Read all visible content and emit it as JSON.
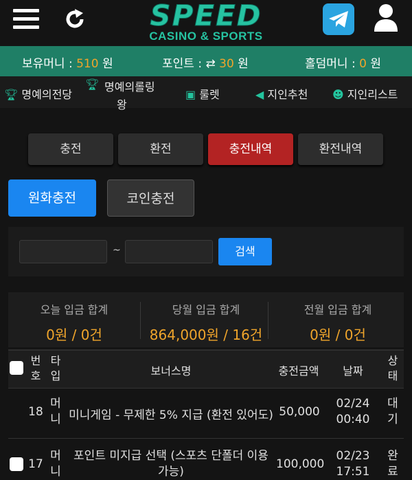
{
  "header": {
    "logo_main": "SPEED",
    "logo_sub": "CASINO & SPORTS"
  },
  "balances": {
    "cash_label": "보유머니 :",
    "cash_value": "510",
    "cash_unit": "원",
    "point_label": "포인트 :",
    "point_value": "30",
    "point_unit": "원",
    "hold_label": "홀덤머니 :",
    "hold_value": "0",
    "hold_unit": "원"
  },
  "menu": {
    "hall_of_fame": "명예의전당",
    "rolling_king_1": "명예의롤링",
    "rolling_king_2": "왕",
    "roulette": "룰렛",
    "referral": "지인추천",
    "referral_list": "지인리스트"
  },
  "tabs": {
    "deposit": "충전",
    "withdraw": "환전",
    "deposit_history": "충전내역",
    "withdraw_history": "환전내역"
  },
  "subtabs": {
    "krw": "원화충전",
    "coin": "코인충전"
  },
  "search": {
    "tilde": "~",
    "button": "검색"
  },
  "summary": {
    "today_label": "오늘 입금 합계",
    "today_value": "0원 / 0건",
    "month_label": "당월 입금 합계",
    "month_value": "864,000원 / 16건",
    "prev_label": "전월 입금 합계",
    "prev_value": "0원 / 0건"
  },
  "table": {
    "col_no_1": "번",
    "col_no_2": "호",
    "col_type_1": "타",
    "col_type_2": "입",
    "col_bonus": "보너스명",
    "col_amount": "충전금액",
    "col_date": "날짜",
    "col_status_1": "상",
    "col_status_2": "태",
    "rows": [
      {
        "no": "18",
        "type_1": "머",
        "type_2": "니",
        "bonus": "미니게임 - 무제한 5% 지급 (환전 있어도)",
        "amount": "50,000",
        "date": "02/24",
        "time": "00:40",
        "status_1": "대",
        "status_2": "기"
      },
      {
        "no": "17",
        "type_1": "머",
        "type_2": "니",
        "bonus_1": "포인트 미지급 선택 (스포츠 단폴더 이용",
        "bonus_2": "가능)",
        "amount": "100,000",
        "date": "02/23",
        "time": "17:51",
        "status_1": "완",
        "status_2": "료"
      }
    ]
  },
  "colors": {
    "accent_green": "#1f7f66",
    "brand_teal": "#26c2a1",
    "value_orange": "#f0a52b",
    "active_red": "#b32323",
    "primary_blue": "#1a86f0"
  }
}
